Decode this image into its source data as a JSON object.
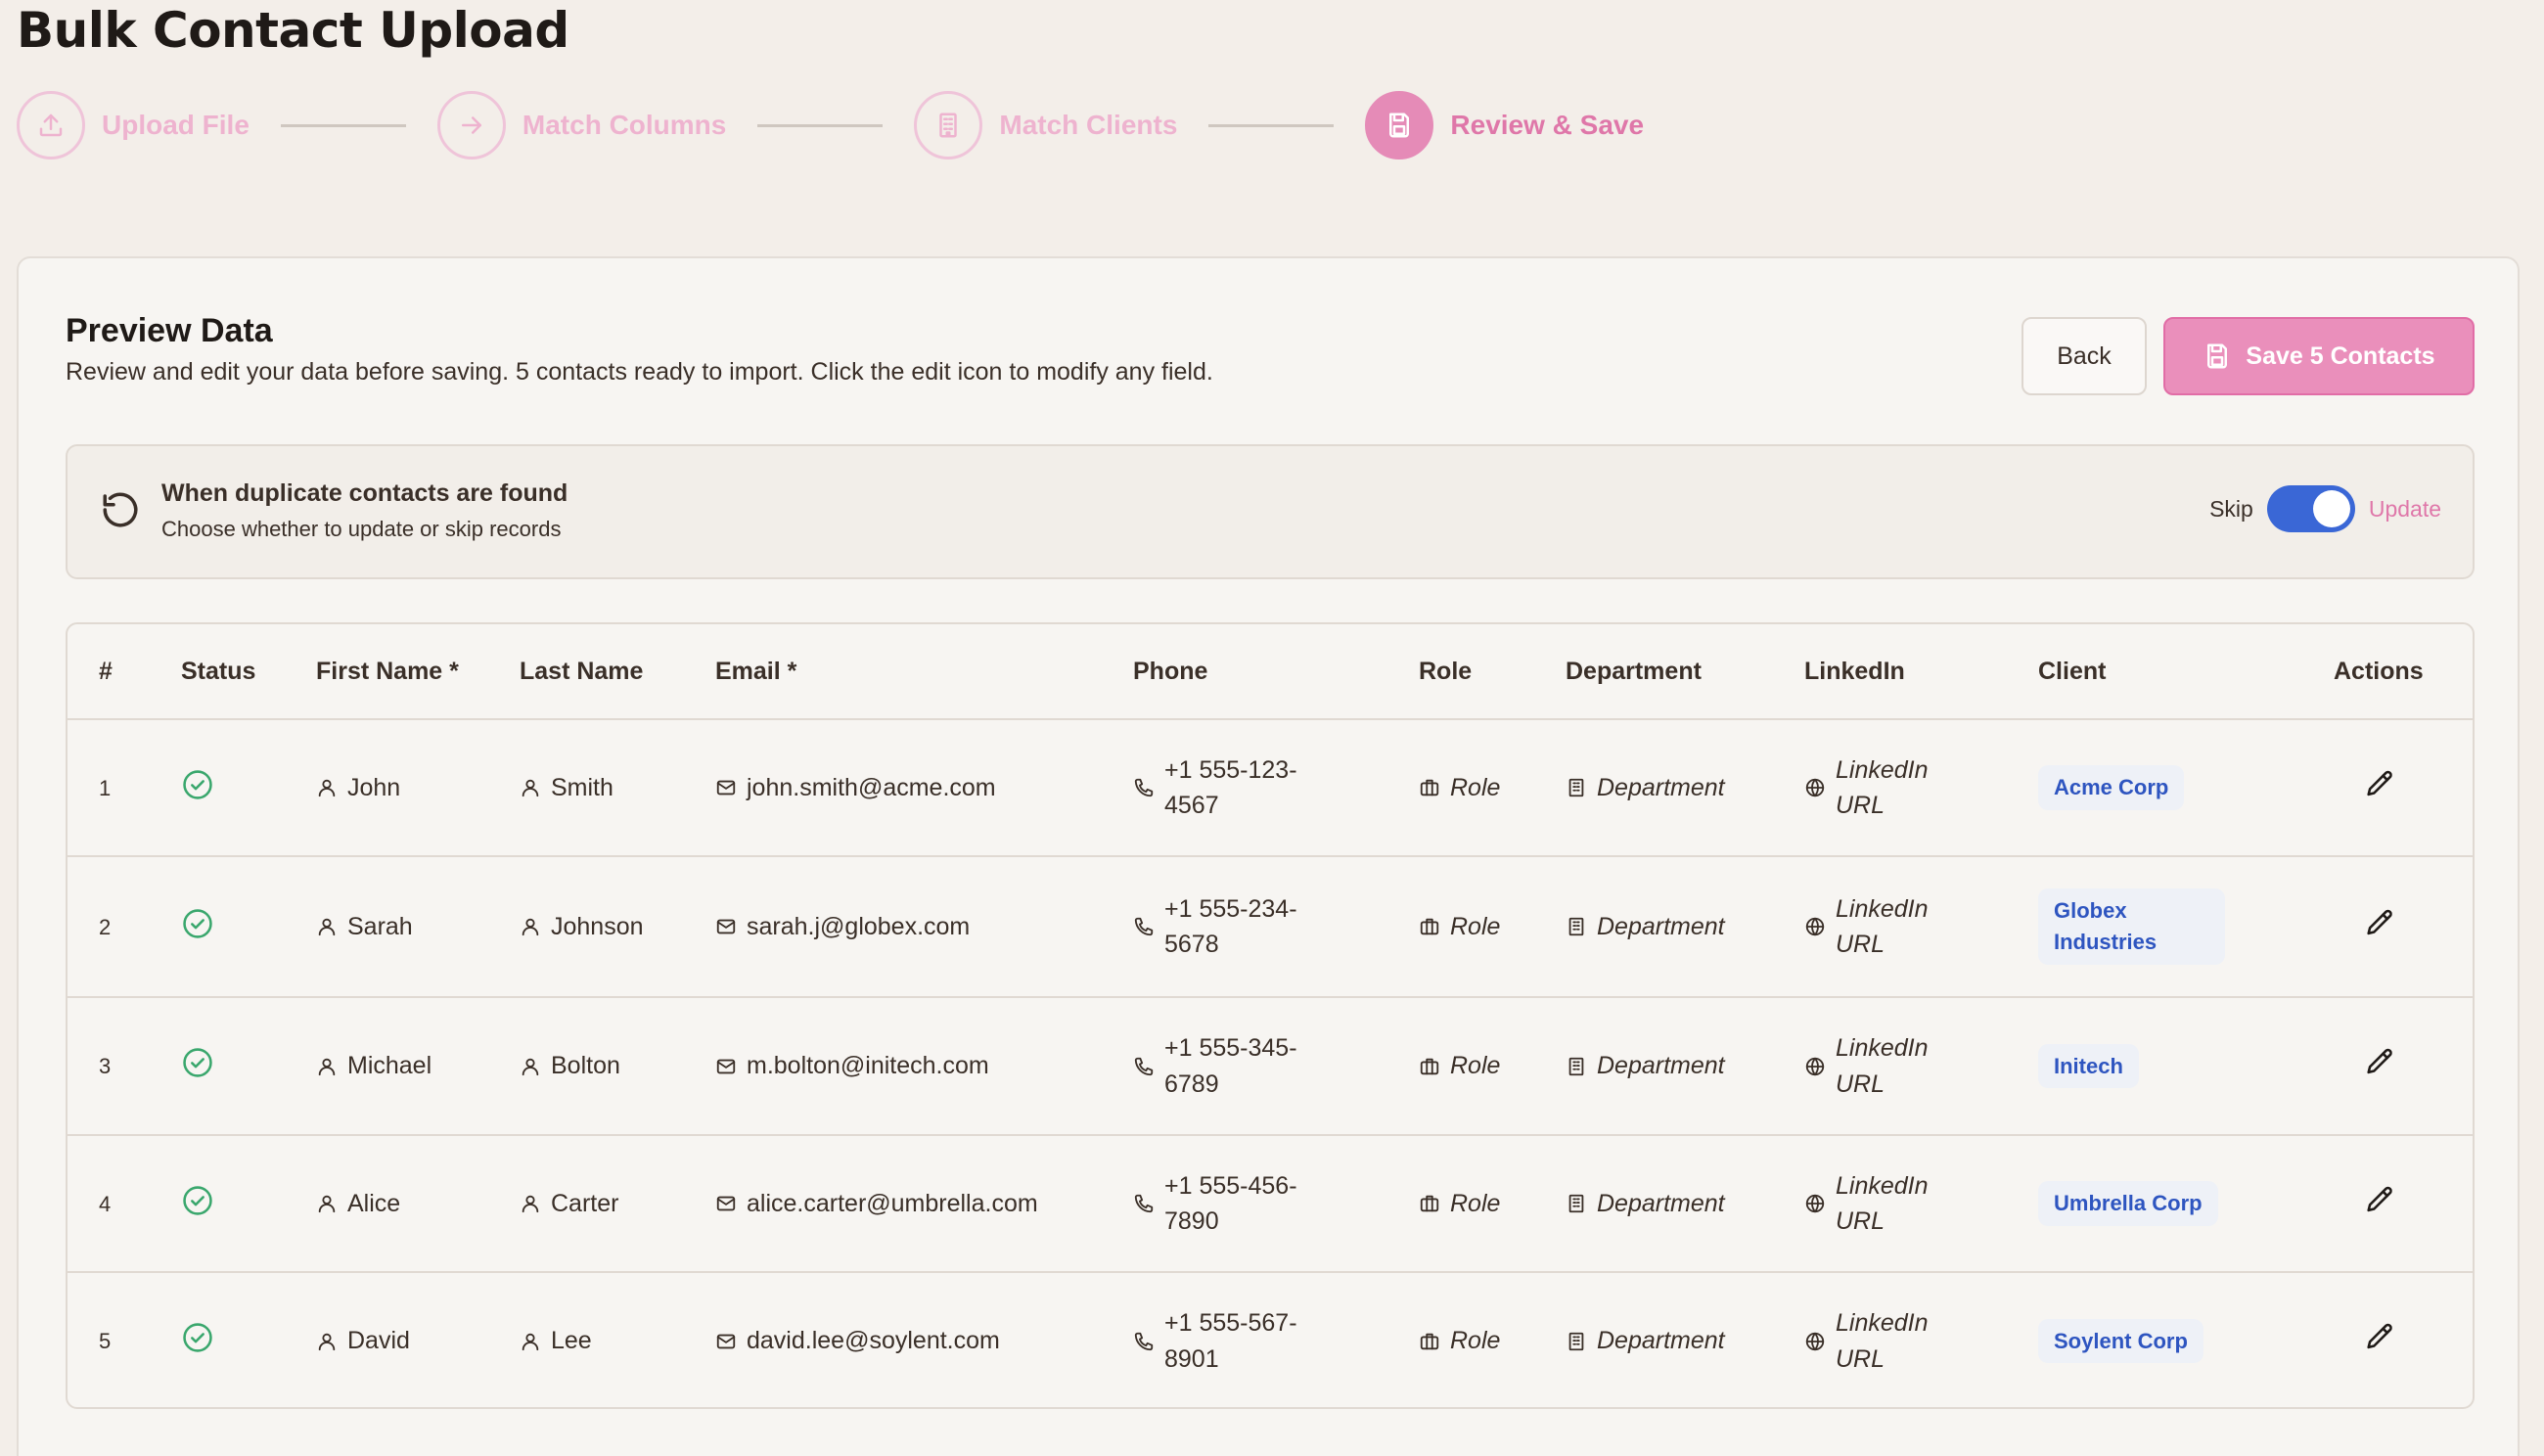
{
  "page": {
    "title": "Bulk Contact Upload"
  },
  "stepper": {
    "steps": [
      {
        "label": "Upload File",
        "icon": "upload-icon",
        "state": "done"
      },
      {
        "label": "Match Columns",
        "icon": "arrow-right-icon",
        "state": "done"
      },
      {
        "label": "Match Clients",
        "icon": "building-icon",
        "state": "done"
      },
      {
        "label": "Review & Save",
        "icon": "save-icon",
        "state": "active"
      }
    ]
  },
  "preview": {
    "title": "Preview Data",
    "description": "Review and edit your data before saving. 5 contacts ready to import. Click the edit icon to modify any field.",
    "back_label": "Back",
    "save_label": "Save 5 Contacts"
  },
  "duplicates": {
    "title": "When duplicate contacts are found",
    "subtitle": "Choose whether to update or skip records",
    "skip_label": "Skip",
    "update_label": "Update",
    "selected": "Update"
  },
  "table": {
    "columns": [
      "#",
      "Status",
      "First Name *",
      "Last Name",
      "Email *",
      "Phone",
      "Role",
      "Department",
      "LinkedIn",
      "Client",
      "Actions"
    ],
    "rows": [
      {
        "num": "1",
        "first": "John",
        "last": "Smith",
        "email": "john.smith@acme.com",
        "phone1": "+1 555-123-",
        "phone2": "4567",
        "role": "Role",
        "department": "Department",
        "linkedin1": "LinkedIn",
        "linkedin2": "URL",
        "client": "Acme Corp"
      },
      {
        "num": "2",
        "first": "Sarah",
        "last": "Johnson",
        "email": "sarah.j@globex.com",
        "phone1": "+1 555-234-",
        "phone2": "5678",
        "role": "Role",
        "department": "Department",
        "linkedin1": "LinkedIn",
        "linkedin2": "URL",
        "client1": "Globex",
        "client2": "Industries"
      },
      {
        "num": "3",
        "first": "Michael",
        "last": "Bolton",
        "email": "m.bolton@initech.com",
        "phone1": "+1 555-345-",
        "phone2": "6789",
        "role": "Role",
        "department": "Department",
        "linkedin1": "LinkedIn",
        "linkedin2": "URL",
        "client": "Initech"
      },
      {
        "num": "4",
        "first": "Alice",
        "last": "Carter",
        "email": "alice.carter@umbrella.com",
        "phone1": "+1 555-456-",
        "phone2": "7890",
        "role": "Role",
        "department": "Department",
        "linkedin1": "LinkedIn",
        "linkedin2": "URL",
        "client": "Umbrella Corp"
      },
      {
        "num": "5",
        "first": "David",
        "last": "Lee",
        "email": "david.lee@soylent.com",
        "phone1": "+1 555-567-",
        "phone2": "8901",
        "role": "Role",
        "department": "Department",
        "linkedin1": "LinkedIn",
        "linkedin2": "URL",
        "client": "Soylent Corp"
      }
    ]
  },
  "colors": {
    "accent_pink": "#e58bb7",
    "toggle_blue": "#3a67d6",
    "status_green": "#3aa76d",
    "badge_blue": "#2e55c0"
  }
}
